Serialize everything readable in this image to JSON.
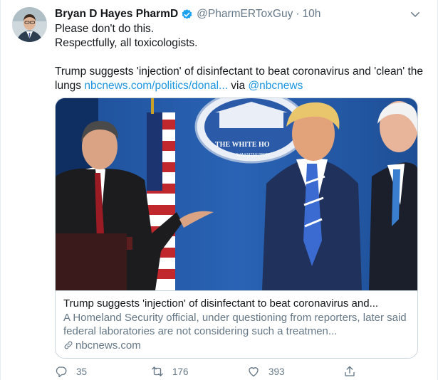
{
  "tweet": {
    "author_name": "Bryan D Hayes PharmD",
    "handle": "@PharmERToxGuy",
    "separator": "·",
    "time": "10h",
    "lines": [
      "Please don't do this.",
      "Respectfully, all toxicologists."
    ],
    "share_text_1": "Trump suggests 'injection' of disinfectant to beat coronavirus and 'clean' the lungs ",
    "share_link": "nbcnews.com/politics/donal...",
    "share_via": " via ",
    "share_mention": "@nbcnews"
  },
  "card": {
    "title": "Trump suggests 'injection' of disinfectant to beat coronavirus and...",
    "description": "A Homeland Security official, under questioning from reporters, later said federal laboratories are not considering such a treatmen...",
    "domain": "nbcnews.com",
    "image_sign_text": "THE WHITE HO",
    "image_sign_subtext": "WASHINGTON"
  },
  "actions": {
    "replies": "35",
    "retweets": "176",
    "likes": "393"
  },
  "colors": {
    "link": "#1b95e0",
    "verified": "#1da1f2",
    "muted": "#657786"
  },
  "icons": [
    "verified-badge-icon",
    "chevron-down-icon",
    "link-icon",
    "reply-icon",
    "retweet-icon",
    "like-icon",
    "share-icon"
  ]
}
